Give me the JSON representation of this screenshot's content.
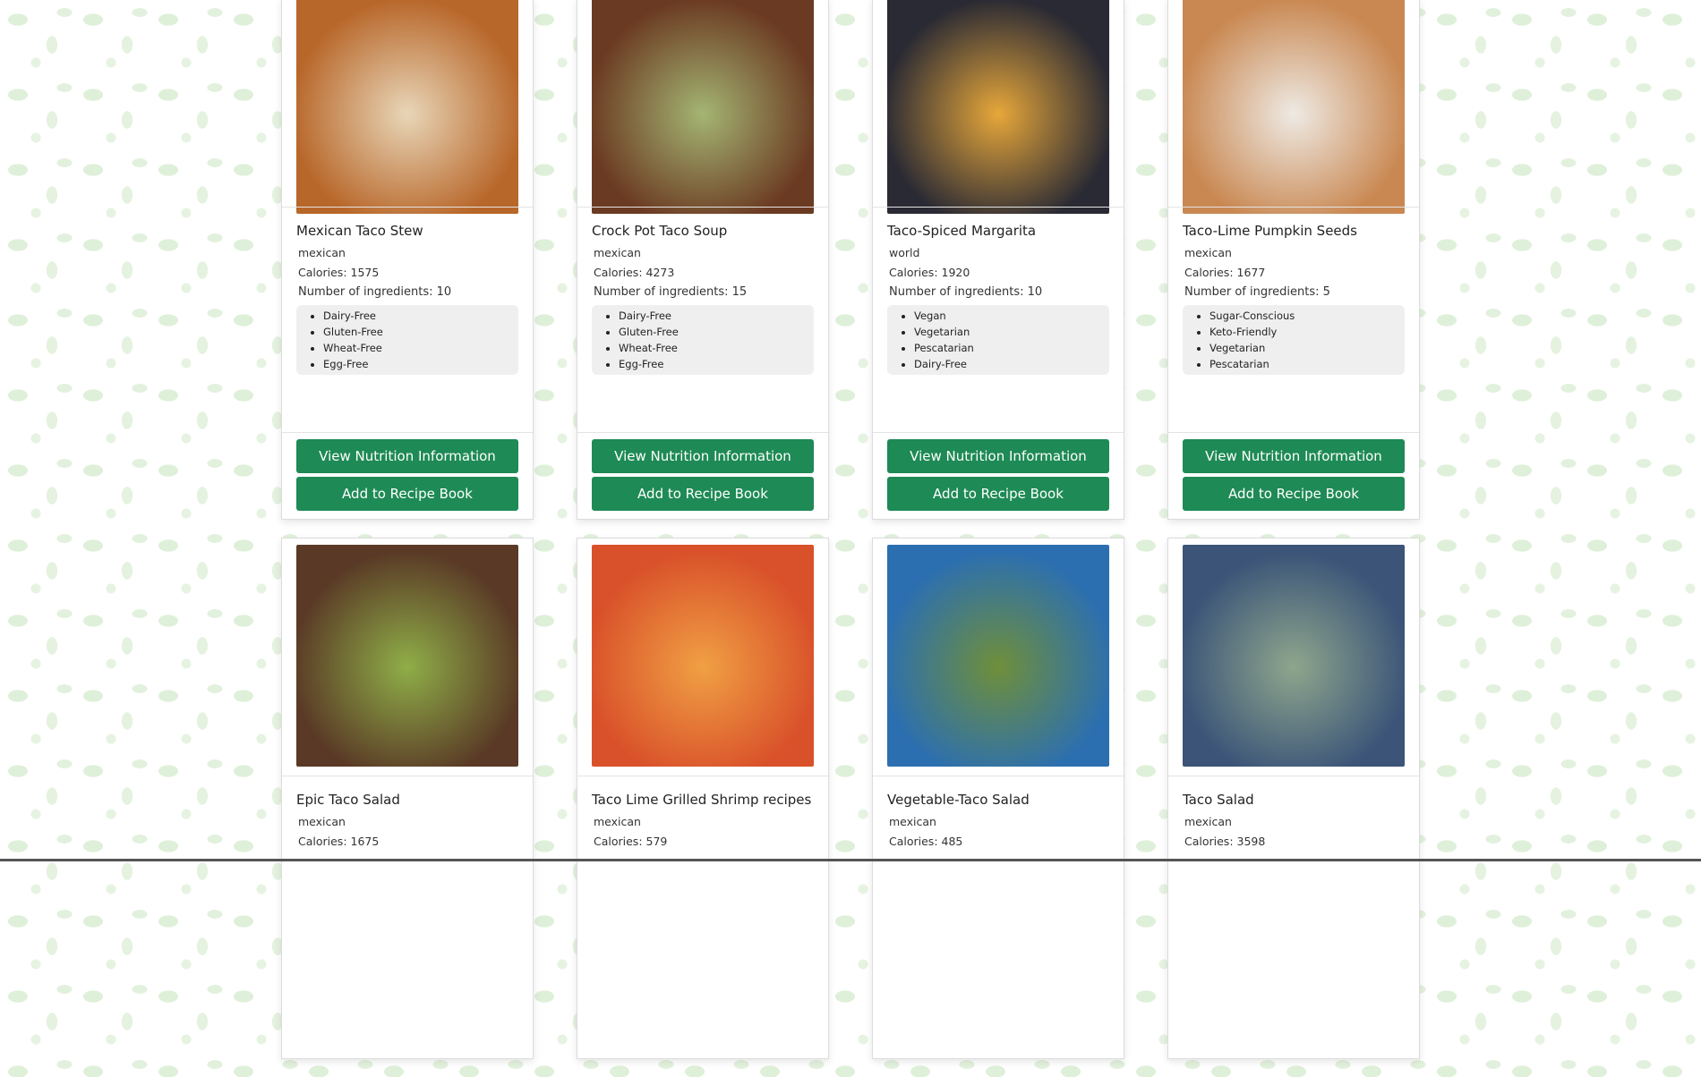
{
  "theme": {
    "button_color": "#1e8a55",
    "label_bg": "#efefef"
  },
  "buttons": {
    "nutrition": "View Nutrition Information",
    "add": "Add to Recipe Book"
  },
  "recipes": [
    {
      "title": "Mexican Taco Stew",
      "cuisine": "mexican",
      "calories": "Calories: 1575",
      "ingredients": "Number of ingredients: 10",
      "labels": [
        "Dairy-Free",
        "Gluten-Free",
        "Wheat-Free",
        "Egg-Free"
      ],
      "image_colors": [
        "#b8672a",
        "#e8d6b8"
      ]
    },
    {
      "title": "Crock Pot Taco Soup",
      "cuisine": "mexican",
      "calories": "Calories: 4273",
      "ingredients": "Number of ingredients: 15",
      "labels": [
        "Dairy-Free",
        "Gluten-Free",
        "Wheat-Free",
        "Egg-Free"
      ],
      "image_colors": [
        "#6b3a22",
        "#a4b573"
      ]
    },
    {
      "title": "Taco-Spiced Margarita",
      "cuisine": "world",
      "calories": "Calories: 1920",
      "ingredients": "Number of ingredients: 10",
      "labels": [
        "Vegan",
        "Vegetarian",
        "Pescatarian",
        "Dairy-Free"
      ],
      "image_colors": [
        "#2a2a34",
        "#e7a73a"
      ]
    },
    {
      "title": "Taco-Lime Pumpkin Seeds",
      "cuisine": "mexican",
      "calories": "Calories: 1677",
      "ingredients": "Number of ingredients: 5",
      "labels": [
        "Sugar-Conscious",
        "Keto-Friendly",
        "Vegetarian",
        "Pescatarian"
      ],
      "image_colors": [
        "#c98852",
        "#eeeae4"
      ]
    },
    {
      "title": "Epic Taco Salad",
      "cuisine": "mexican",
      "calories": "Calories: 1675",
      "image_colors": [
        "#5a3a26",
        "#8fae48"
      ]
    },
    {
      "title": "Taco Lime Grilled Shrimp recipes",
      "cuisine": "mexican",
      "calories": "Calories: 579",
      "image_colors": [
        "#d9512a",
        "#f0a044"
      ]
    },
    {
      "title": "Vegetable-Taco Salad",
      "cuisine": "mexican",
      "calories": "Calories: 485",
      "image_colors": [
        "#2c6fb0",
        "#6f8f3a"
      ]
    },
    {
      "title": "Taco Salad",
      "cuisine": "mexican",
      "calories": "Calories: 3598",
      "image_colors": [
        "#3b5478",
        "#8ea68c"
      ]
    }
  ]
}
